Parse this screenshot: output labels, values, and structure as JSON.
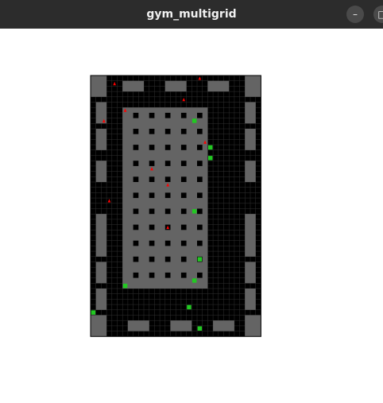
{
  "window": {
    "title": "gym_multigrid",
    "minimize_icon": "minimize-icon",
    "maximize_icon": "maximize-icon"
  },
  "grid": {
    "cols": 32,
    "rows": 49,
    "colors": {
      "floor": "#000000",
      "gridline": "#303030",
      "wall": "#646464",
      "agent": "#ff0000",
      "ball": "#22c922"
    },
    "walls": [
      [
        0,
        0,
        3,
        4
      ],
      [
        29,
        0,
        3,
        4
      ],
      [
        0,
        45,
        3,
        4
      ],
      [
        29,
        45,
        3,
        4
      ],
      [
        6,
        1,
        4,
        2
      ],
      [
        14,
        1,
        4,
        2
      ],
      [
        22,
        1,
        4,
        2
      ],
      [
        7,
        46,
        4,
        2
      ],
      [
        15,
        46,
        4,
        2
      ],
      [
        23,
        46,
        4,
        2
      ],
      [
        1,
        5,
        2,
        4
      ],
      [
        1,
        10,
        2,
        4
      ],
      [
        1,
        16,
        2,
        4
      ],
      [
        1,
        26,
        2,
        4
      ],
      [
        1,
        30,
        2,
        4
      ],
      [
        1,
        35,
        2,
        4
      ],
      [
        1,
        40,
        2,
        4
      ],
      [
        29,
        5,
        2,
        4
      ],
      [
        29,
        10,
        2,
        4
      ],
      [
        29,
        16,
        2,
        4
      ],
      [
        29,
        26,
        2,
        4
      ],
      [
        29,
        30,
        2,
        4
      ],
      [
        29,
        35,
        2,
        4
      ],
      [
        29,
        40,
        2,
        4
      ],
      [
        6,
        6,
        16,
        34
      ]
    ],
    "holes_start": [
      8,
      7
    ],
    "holes_step": [
      3,
      3
    ],
    "holes_count": [
      5,
      11
    ],
    "agents": [
      [
        4,
        1
      ],
      [
        20,
        0
      ],
      [
        2,
        8
      ],
      [
        17,
        4
      ],
      [
        6,
        6
      ],
      [
        21,
        12
      ],
      [
        11,
        17
      ],
      [
        14,
        20
      ],
      [
        3,
        23
      ],
      [
        14,
        28
      ]
    ],
    "balls": [
      [
        19,
        8
      ],
      [
        22,
        13
      ],
      [
        22,
        15
      ],
      [
        19,
        25
      ],
      [
        20,
        34
      ],
      [
        19,
        38
      ],
      [
        6,
        39
      ],
      [
        0,
        44
      ],
      [
        18,
        43
      ],
      [
        20,
        47
      ]
    ]
  }
}
